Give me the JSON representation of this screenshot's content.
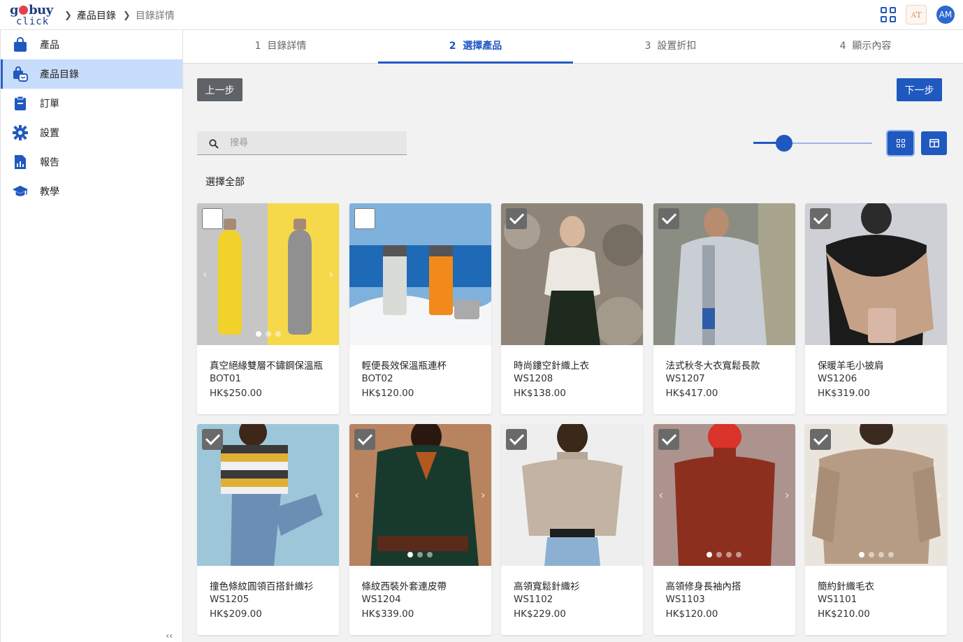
{
  "header": {
    "logo_top": "gobuy",
    "logo_bottom": "click",
    "breadcrumb": [
      "產品目錄",
      "目錄詳情"
    ],
    "lang_label": "A͛T",
    "avatar_initials": "AM"
  },
  "sidebar": {
    "items": [
      {
        "label": "產品",
        "icon": "shopping-bag-icon"
      },
      {
        "label": "產品目錄",
        "icon": "catalog-bag-icon",
        "active": true
      },
      {
        "label": "訂單",
        "icon": "clipboard-icon"
      },
      {
        "label": "設置",
        "icon": "gear-icon"
      },
      {
        "label": "報告",
        "icon": "report-icon"
      },
      {
        "label": "教學",
        "icon": "graduation-cap-icon"
      }
    ],
    "collapse_label": "‹‹"
  },
  "stepper": {
    "steps": [
      {
        "num": "1",
        "label": "目錄詳情"
      },
      {
        "num": "2",
        "label": "選擇產品",
        "active": true
      },
      {
        "num": "3",
        "label": "設置折扣"
      },
      {
        "num": "4",
        "label": "顯示內容"
      }
    ]
  },
  "actions": {
    "prev_label": "上一步",
    "next_label": "下一步"
  },
  "search": {
    "placeholder": "搜尋",
    "value": ""
  },
  "zoom_slider": {
    "value": 0.26
  },
  "select_all_label": "選擇全部",
  "colors": {
    "primary": "#1f59c0",
    "active_nav_bg": "#c8dcfb",
    "checkbox_checked": "#6a6a6a"
  },
  "products": [
    {
      "name": "真空絕緣雙層不鏽鋼保溫瓶",
      "sku": "BOT01",
      "price": "HK$250.00",
      "checked": false,
      "image": "yellow-grey-bottles",
      "carousel_dots": 3
    },
    {
      "name": "輕便長效保溫瓶連杯",
      "sku": "BOT02",
      "price": "HK$120.00",
      "checked": false,
      "image": "flasks-on-snow",
      "carousel_dots": 0
    },
    {
      "name": "時尚鏤空針織上衣",
      "sku": "WS1208",
      "price": "HK$138.00",
      "checked": true,
      "image": "cream-knit-top",
      "carousel_dots": 0
    },
    {
      "name": "法式秋冬大衣寬鬆長款",
      "sku": "WS1207",
      "price": "HK$417.00",
      "checked": true,
      "image": "grey-coat",
      "carousel_dots": 0
    },
    {
      "name": "保暖羊毛小披肩",
      "sku": "WS1206",
      "price": "HK$319.00",
      "checked": true,
      "image": "wool-shawl",
      "carousel_dots": 0
    },
    {
      "name": "撞色條紋圓領百搭針織衫",
      "sku": "WS1205",
      "price": "HK$209.00",
      "checked": true,
      "image": "striped-sweater",
      "carousel_dots": 0
    },
    {
      "name": "條紋西裝外套連皮帶",
      "sku": "WS1204",
      "price": "HK$339.00",
      "checked": true,
      "image": "green-blazer",
      "carousel_dots": 3
    },
    {
      "name": "高領寬鬆針織衫",
      "sku": "WS1102",
      "price": "HK$229.00",
      "checked": true,
      "image": "turtleneck-knit",
      "carousel_dots": 0
    },
    {
      "name": "高領修身長袖內搭",
      "sku": "WS1103",
      "price": "HK$120.00",
      "checked": true,
      "image": "rust-turtleneck",
      "carousel_dots": 4
    },
    {
      "name": "簡約針織毛衣",
      "sku": "WS1101",
      "price": "HK$210.00",
      "checked": true,
      "image": "beige-sweater",
      "carousel_dots": 4
    }
  ]
}
